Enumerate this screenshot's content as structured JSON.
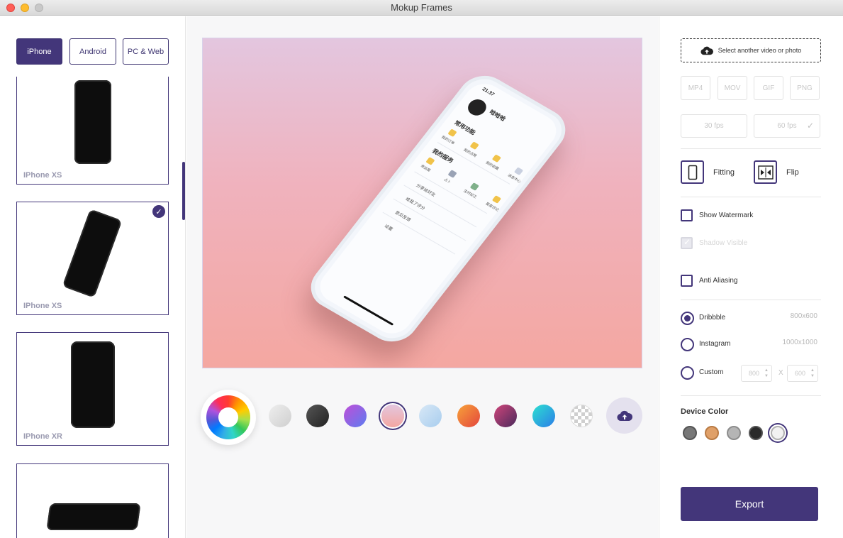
{
  "window": {
    "title": "Mokup Frames"
  },
  "sidebar": {
    "tabs": [
      {
        "label": "iPhone",
        "active": true
      },
      {
        "label": "Android",
        "active": false
      },
      {
        "label": "PC & Web",
        "active": false
      }
    ],
    "devices": [
      {
        "name": "IPhone XS",
        "selected": false
      },
      {
        "name": "IPhone XS",
        "selected": true
      },
      {
        "name": "IPhone XR",
        "selected": false
      },
      {
        "name": "",
        "selected": false
      }
    ]
  },
  "preview": {
    "phone_screen": {
      "time": "21:37",
      "user_name": "哈哈哈",
      "section_common": "常用功能",
      "section_service": "我的服务",
      "common_items": [
        "我的订单",
        "我的点赞",
        "我的收藏",
        "消息中心"
      ],
      "service_items": [
        "幸运星",
        "占卜",
        "生时校正",
        "星座日记"
      ],
      "list_items": [
        "分享给好友",
        "给我了评分",
        "意见反馈",
        "设置"
      ]
    }
  },
  "backgrounds": {
    "swatches": [
      {
        "name": "light-gray",
        "color": "#dcdcdc"
      },
      {
        "name": "dark-gray",
        "color": "#3a3a3a"
      },
      {
        "name": "purple-blue",
        "color": "#8a5be8"
      },
      {
        "name": "pink",
        "color": "#f0b2bd",
        "selected": true
      },
      {
        "name": "light-blue",
        "color": "#bcd9f2"
      },
      {
        "name": "orange-red",
        "color": "#ee6a3b"
      },
      {
        "name": "wine",
        "color": "#8a2f5c"
      },
      {
        "name": "cyan",
        "color": "#23b0e3"
      },
      {
        "name": "transparent",
        "color": "checker"
      }
    ]
  },
  "panel": {
    "select_media_label": "Select another video or photo",
    "formats": [
      "MP4",
      "MOV",
      "GIF",
      "PNG"
    ],
    "fps": [
      {
        "label": "30 fps",
        "checked": false
      },
      {
        "label": "60 fps",
        "checked": true
      }
    ],
    "fitting_label": "Fitting",
    "flip_label": "Flip",
    "show_watermark_label": "Show Watermark",
    "shadow_visible_label": "Shadow Visible",
    "anti_aliasing_label": "Anti Aliasing",
    "sizes": [
      {
        "label": "Dribbble",
        "resolution": "800x600",
        "checked": true
      },
      {
        "label": "Instagram",
        "resolution": "1000x1000",
        "checked": false
      },
      {
        "label": "Custom",
        "resolution": "",
        "checked": false
      }
    ],
    "custom_width": "800",
    "custom_height": "600",
    "custom_x": "X",
    "device_color_title": "Device Color",
    "device_colors": [
      {
        "name": "gray",
        "color": "#777777"
      },
      {
        "name": "gold",
        "color": "#e0a068"
      },
      {
        "name": "silver",
        "color": "#b5b5b5"
      },
      {
        "name": "black",
        "color": "#2a2a2a"
      },
      {
        "name": "white",
        "color": "#f2f2f2",
        "selected": true
      }
    ],
    "export_label": "Export"
  }
}
